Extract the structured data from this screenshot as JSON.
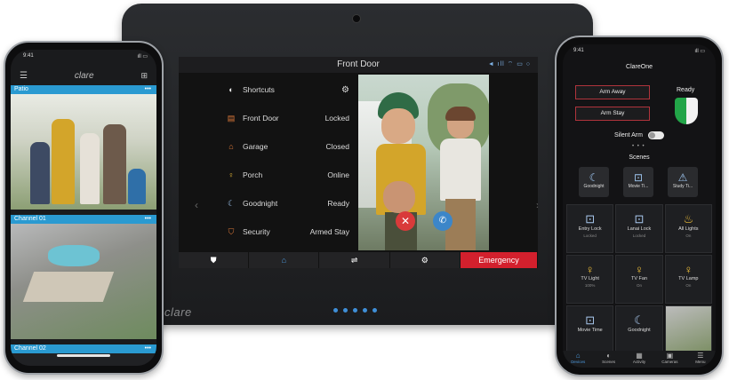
{
  "tablet": {
    "title": "Front Door",
    "status_icons": "◄ ıll ⌔ ▭ ○",
    "shortcuts_label": "Shortcuts",
    "rows": [
      {
        "label": "Front Door",
        "value": "Locked"
      },
      {
        "label": "Garage",
        "value": "Closed"
      },
      {
        "label": "Porch",
        "value": "Online"
      },
      {
        "label": "Goodnight",
        "value": "Ready"
      },
      {
        "label": "Security",
        "value": "Armed Stay"
      }
    ],
    "emergency_label": "Emergency",
    "brand": "clare",
    "accent": "#3f8fd8",
    "emergency_color": "#d3202d"
  },
  "left_phone": {
    "status_time": "9:41",
    "brand": "clare",
    "cameras": [
      {
        "label": "Patio",
        "more": "•••"
      },
      {
        "label": "Channel 01",
        "more": "•••"
      },
      {
        "label": "Channel 02",
        "more": "•••"
      }
    ]
  },
  "right_phone": {
    "status_time": "9:41",
    "title": "ClareOne",
    "arm_away": "Arm Away",
    "arm_stay": "Arm Stay",
    "ready_label": "Ready",
    "silent_arm": "Silent Arm",
    "scenes_title": "Scenes",
    "scenes": [
      {
        "label": "Goodnight",
        "icon": "moon-icon"
      },
      {
        "label": "Movie Ti...",
        "icon": "lock-icon"
      },
      {
        "label": "Study Ti...",
        "icon": "alert-icon"
      }
    ],
    "tiles": [
      {
        "label": "Entry Lock",
        "sub": "Locked",
        "icon": "lock-icon"
      },
      {
        "label": "Lanai Lock",
        "sub": "Locked",
        "icon": "lock-icon"
      },
      {
        "label": "All Lights",
        "sub": "On",
        "icon": "bulb-icon"
      },
      {
        "label": "TV Light",
        "sub": "100%",
        "icon": "bulb-icon"
      },
      {
        "label": "TV Fan",
        "sub": "On",
        "icon": "bulb-icon"
      },
      {
        "label": "TV Lamp",
        "sub": "On",
        "icon": "bulb-icon"
      },
      {
        "label": "Movie Time",
        "sub": "",
        "icon": "lock-icon"
      },
      {
        "label": "Goodnight",
        "sub": "",
        "icon": "moon-icon"
      },
      {
        "label": "",
        "sub": "",
        "icon": "camera-feed"
      }
    ],
    "tabs": [
      "Devices",
      "Scenes",
      "Activity",
      "Cameras",
      "Menu"
    ]
  }
}
